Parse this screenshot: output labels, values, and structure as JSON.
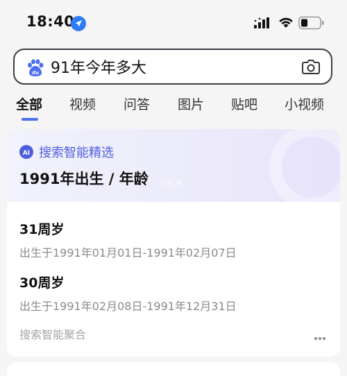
{
  "status_bar": {
    "time": "18:40"
  },
  "search": {
    "query": "91年今年多大"
  },
  "tabs": [
    {
      "label": "全部",
      "active": true
    },
    {
      "label": "视频",
      "active": false
    },
    {
      "label": "问答",
      "active": false
    },
    {
      "label": "图片",
      "active": false
    },
    {
      "label": "贴吧",
      "active": false
    },
    {
      "label": "小视频",
      "active": false
    }
  ],
  "ai_card": {
    "badge_text": "AI",
    "header_label": "搜索智能精选",
    "title": "1991年出生 / 年龄",
    "watermark": "小红书",
    "items": [
      {
        "age": "31周岁",
        "range": "出生于1991年01月01日-1991年02月07日"
      },
      {
        "age": "30周岁",
        "range": "出生于1991年02月08日-1991年12月31日"
      }
    ],
    "footer_label": "搜索智能聚合"
  },
  "colors": {
    "accent": "#4e6ef2",
    "ai_text": "#4e5ee0",
    "secondary_text": "#8a8a8f"
  }
}
